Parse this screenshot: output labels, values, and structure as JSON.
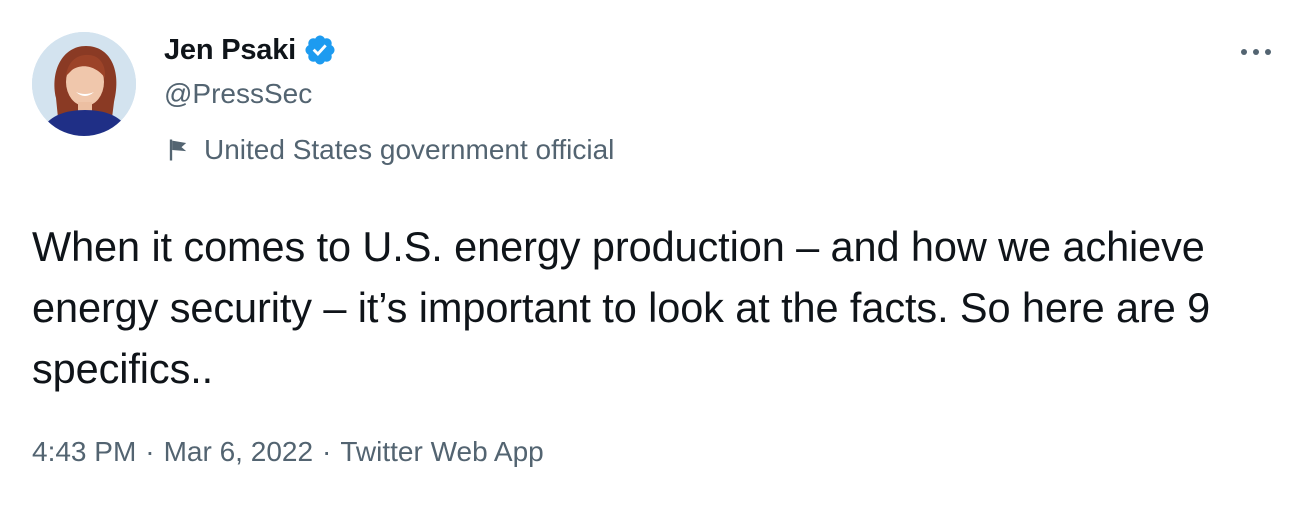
{
  "author": {
    "display_name": "Jen Psaki",
    "handle": "@PressSec",
    "verified": true,
    "avatar_icon": "profile-photo"
  },
  "label": {
    "icon": "flag-icon",
    "text": "United States government official"
  },
  "more_icon": "ellipsis-icon",
  "tweet": {
    "text": "When it comes to U.S. energy production – and how we achieve energy security – it’s important to look at the facts. So here are 9 specifics.."
  },
  "meta": {
    "time": "4:43 PM",
    "separator": "·",
    "date": "Mar 6, 2022",
    "source": "Twitter Web App"
  },
  "colors": {
    "text_primary": "#0f1419",
    "text_secondary": "#536471",
    "verified_blue": "#1d9bf0"
  }
}
